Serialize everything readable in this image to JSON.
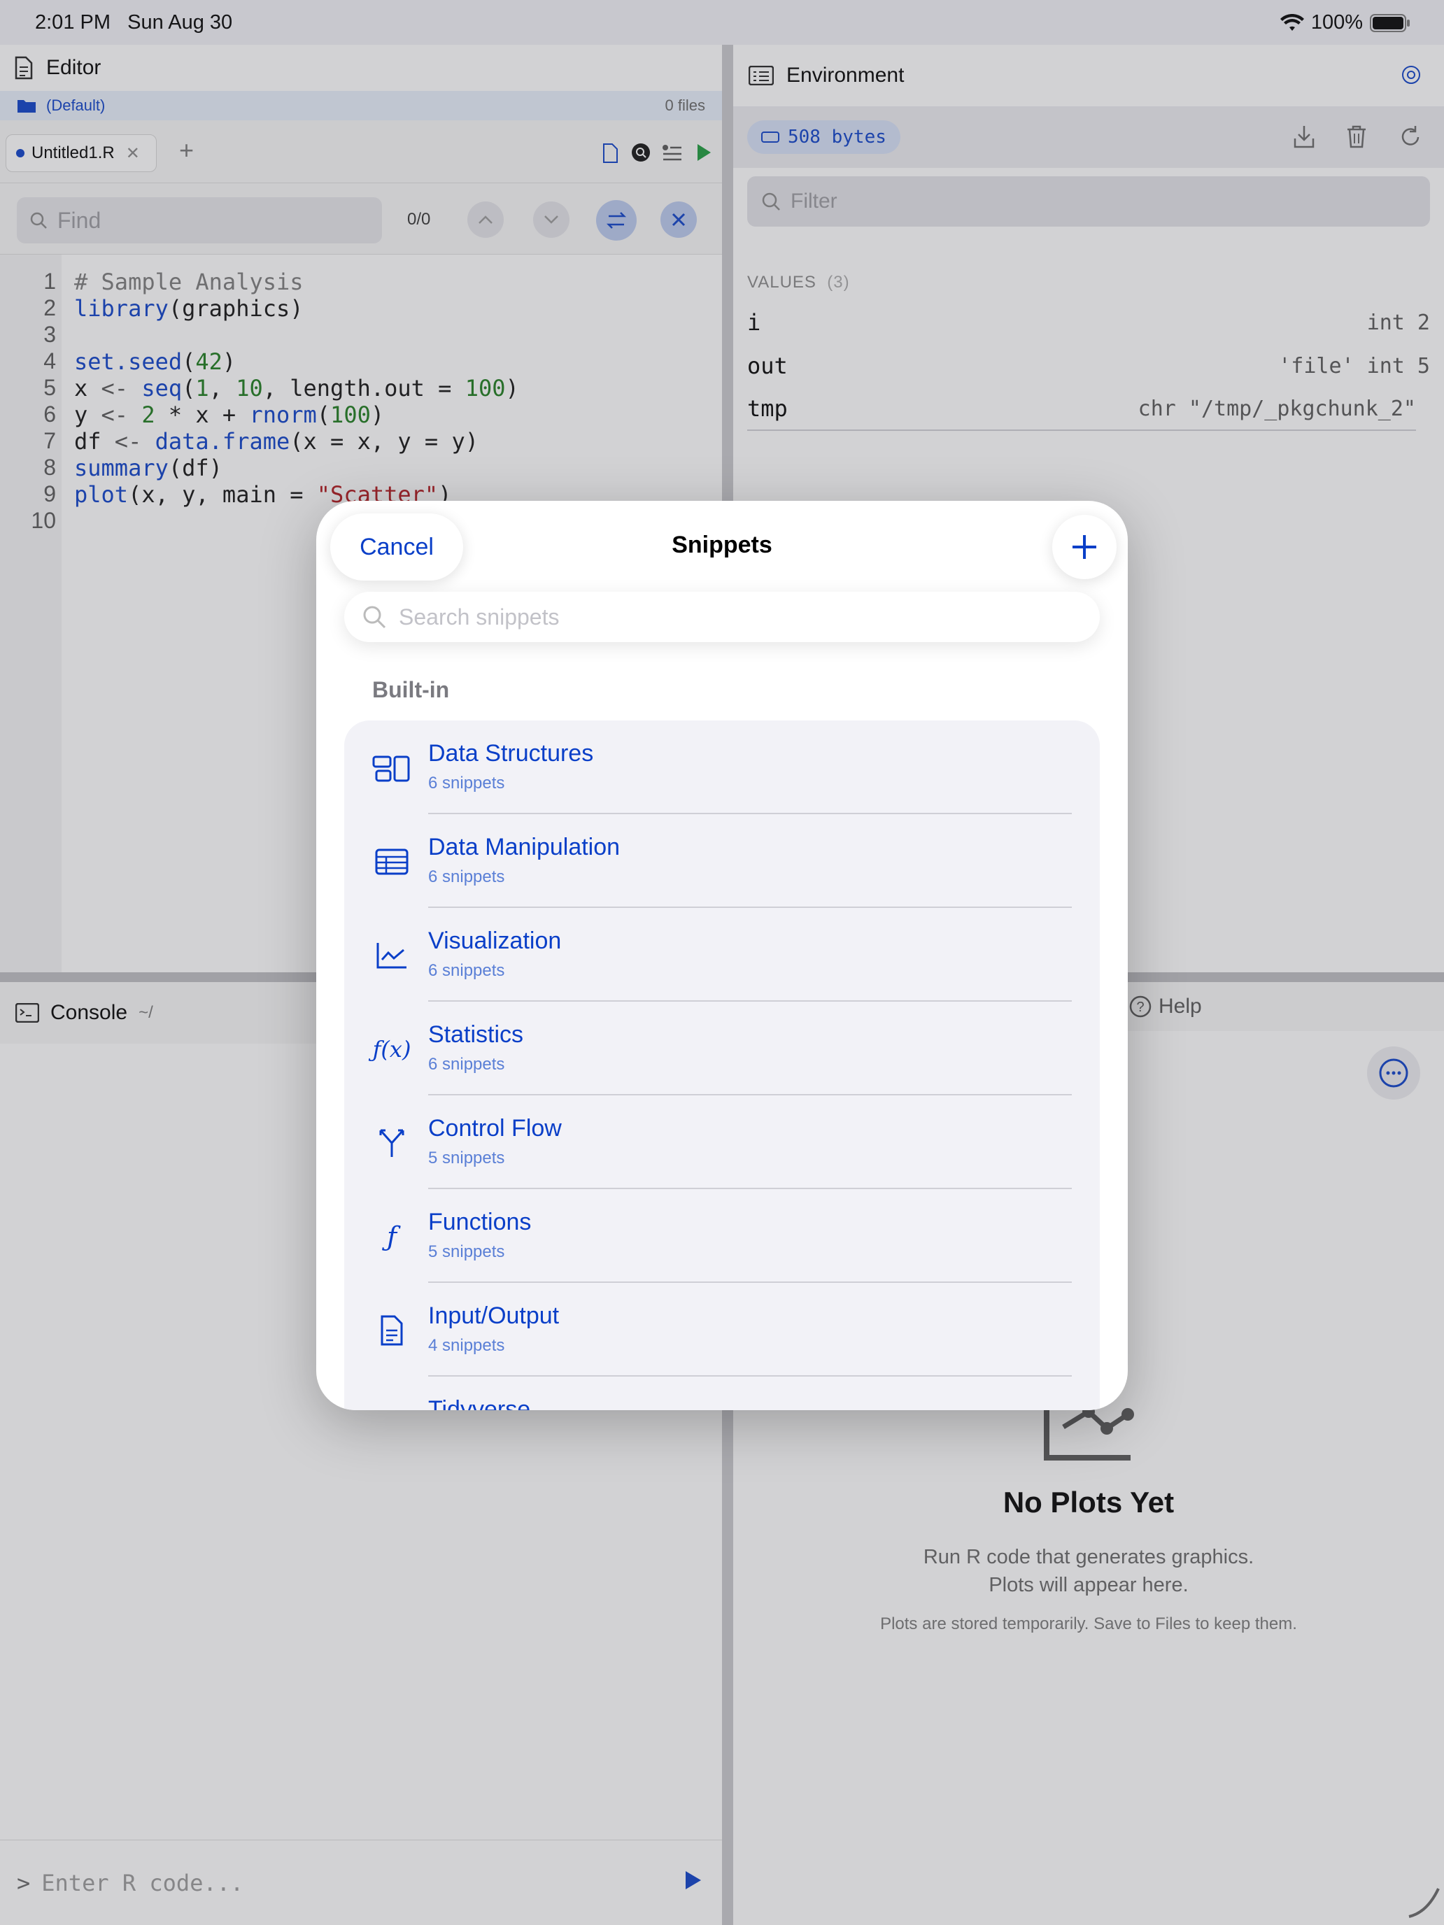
{
  "status": {
    "time": "2:01 PM",
    "date": "Sun Aug 30",
    "battery": "100%"
  },
  "editor": {
    "title": "Editor",
    "project": "(Default)",
    "files": "0 files",
    "tab": "Untitled1.R",
    "find_placeholder": "Find",
    "find_count": "0/0",
    "lines": [
      "1",
      "2",
      "3",
      "4",
      "5",
      "6",
      "7",
      "8",
      "9",
      "10"
    ]
  },
  "console": {
    "title": "Console",
    "cwd": "~/",
    "placeholder": "Enter R code..."
  },
  "environment": {
    "title": "Environment",
    "size": "508 bytes",
    "filter_placeholder": "Filter",
    "values_label": "VALUES",
    "values_count": "(3)",
    "vars": [
      {
        "name": "i",
        "value": "int 2"
      },
      {
        "name": "out",
        "value": "'file' int 5"
      },
      {
        "name": "tmp",
        "value": "chr \"/tmp/_pkgchunk_2\""
      }
    ]
  },
  "plots": {
    "help_tab": "Help",
    "empty_title": "No Plots Yet",
    "empty_line1": "Run R code that generates graphics.",
    "empty_line2": "Plots will appear here.",
    "empty_note": "Plots are stored temporarily. Save to Files to keep them."
  },
  "modal": {
    "cancel": "Cancel",
    "title": "Snippets",
    "search_placeholder": "Search snippets",
    "section": "Built-in",
    "items": [
      {
        "name": "Data Structures",
        "count": "6 snippets",
        "icon": "data-structures-icon"
      },
      {
        "name": "Data Manipulation",
        "count": "6 snippets",
        "icon": "table-icon"
      },
      {
        "name": "Visualization",
        "count": "6 snippets",
        "icon": "chart-line-icon"
      },
      {
        "name": "Statistics",
        "count": "6 snippets",
        "icon": "function-fx-icon"
      },
      {
        "name": "Control Flow",
        "count": "5 snippets",
        "icon": "branch-icon"
      },
      {
        "name": "Functions",
        "count": "5 snippets",
        "icon": "function-f-icon"
      },
      {
        "name": "Input/Output",
        "count": "4 snippets",
        "icon": "document-icon"
      },
      {
        "name": "Tidyverse",
        "count": "",
        "icon": ""
      }
    ]
  },
  "colors": {
    "accent": "#0a3fc8",
    "run_green": "#1a9a3a"
  }
}
